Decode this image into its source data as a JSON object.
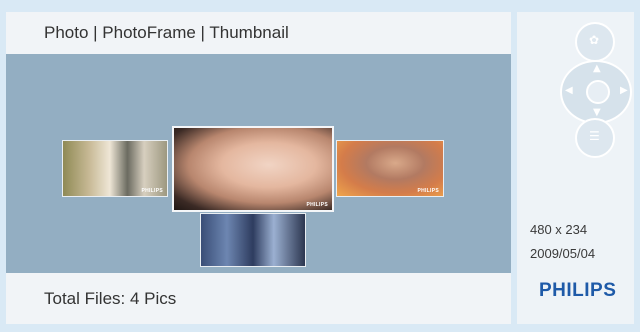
{
  "breadcrumb": "Photo | PhotoFrame | Thumbnail",
  "thumbnails": [
    {
      "name": "thumbnail-wedding",
      "brand": "PHILIPS"
    },
    {
      "name": "thumbnail-baby",
      "brand": "PHILIPS",
      "selected": true
    },
    {
      "name": "thumbnail-girl",
      "brand": "PHILIPS"
    },
    {
      "name": "thumbnail-graduation",
      "brand": ""
    }
  ],
  "footer": {
    "total_files": "Total Files: 4 Pics"
  },
  "info": {
    "dimensions": "480 x 234",
    "date": "2009/05/04"
  },
  "brand": {
    "logo_text": "PHILIPS",
    "color": "#1e5aa8"
  },
  "icons": [
    "settings-icon",
    "dpad-icon",
    "menu-icon"
  ]
}
